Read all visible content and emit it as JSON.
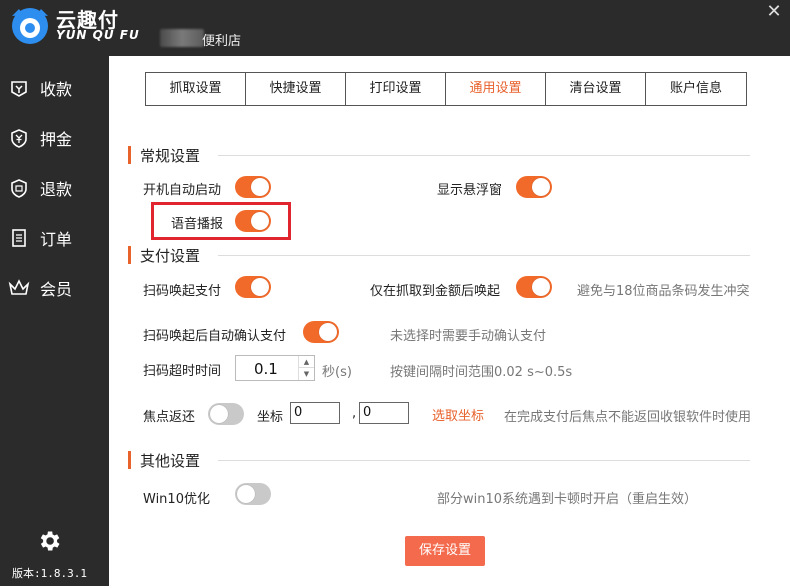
{
  "app": {
    "brand_cn": "云趣付",
    "brand_en": "YUN QU FU",
    "store_suffix": "便利店",
    "close_glyph": "✕"
  },
  "sidebar": {
    "items": [
      {
        "label": "收款",
        "icon": "receive-icon"
      },
      {
        "label": "押金",
        "icon": "deposit-icon"
      },
      {
        "label": "退款",
        "icon": "refund-icon"
      },
      {
        "label": "订单",
        "icon": "order-icon"
      },
      {
        "label": "会员",
        "icon": "crown-icon"
      }
    ],
    "version": "版本:1.8.3.1"
  },
  "tabs": [
    {
      "label": "抓取设置",
      "active": false
    },
    {
      "label": "快捷设置",
      "active": false
    },
    {
      "label": "打印设置",
      "active": false
    },
    {
      "label": "通用设置",
      "active": true
    },
    {
      "label": "清台设置",
      "active": false
    },
    {
      "label": "账户信息",
      "active": false
    }
  ],
  "general": {
    "title": "常规设置",
    "autostart_label": "开机自动启动",
    "autostart_on": true,
    "float_label": "显示悬浮窗",
    "float_on": true,
    "voice_label": "语音播报",
    "voice_on": true
  },
  "payment": {
    "title": "支付设置",
    "scan_label": "扫码唤起支付",
    "scan_on": true,
    "amount_only_label": "仅在抓取到金额后唤起",
    "amount_only_on": true,
    "amount_only_hint": "避免与18位商品条码发生冲突",
    "auto_confirm_label": "扫码唤起后自动确认支付",
    "auto_confirm_on": true,
    "auto_confirm_hint": "未选择时需要手动确认支付",
    "timeout_label": "扫码超时时间",
    "timeout_value": "0.1",
    "timeout_unit": "秒(s)",
    "timeout_hint": "按键间隔时间范围0.02 s~0.5s",
    "focus_label": "焦点返还",
    "focus_on": false,
    "coord_label": "坐标",
    "coord_x": "0",
    "coord_sep": ",",
    "coord_y": "0",
    "pick_coord_label": "选取坐标",
    "focus_hint": "在完成支付后焦点不能返回收银软件时使用"
  },
  "other": {
    "title": "其他设置",
    "win10_label": "Win10优化",
    "win10_on": false,
    "win10_hint": "部分win10系统遇到卡顿时开启（重启生效）"
  },
  "save_label": "保存设置",
  "colors": {
    "accent": "#f26a2a",
    "sidebar_bg": "#2b2b2b",
    "highlight": "#e0252e",
    "save_button": "#f46a4d"
  }
}
